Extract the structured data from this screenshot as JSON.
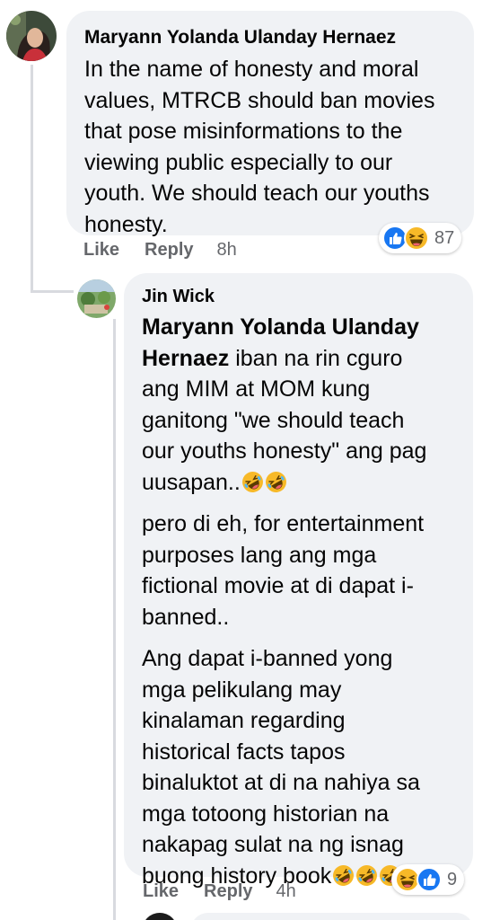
{
  "comment1": {
    "author": "Maryann Yolanda Ulanday Hernaez",
    "lines": [
      "In the name of honesty and moral",
      "values, MTRCB should ban movies",
      "that pose misinformations to the",
      "viewing public especially to our",
      "youth. We should teach our youths",
      "honesty."
    ],
    "actions": {
      "like": "Like",
      "reply": "Reply",
      "time": "8h"
    },
    "reactions": {
      "icons": [
        "like-icon",
        "haha-icon"
      ],
      "count": "87"
    }
  },
  "reply1": {
    "author": "Jin Wick",
    "mention_line1": "Maryann Yolanda Ulanday",
    "mention_line2": "Hernaez",
    "mention_tail": " iban na rin cguro",
    "p1_lines": [
      "ang MIM at MOM kung",
      "ganitong \"we should teach",
      "our youths honesty\" ang pag",
      "uusapan.."
    ],
    "p2_lines": [
      "pero di eh, for entertainment",
      "purposes lang ang mga",
      "fictional movie at di dapat i-",
      "banned.."
    ],
    "p3_lines": [
      "Ang dapat i-banned yong",
      "mga pelikulang may",
      "kinalaman regarding",
      "historical facts tapos",
      "binaluktot at di na nahiya sa",
      "mga totoong historian na",
      "nakapag sulat na ng isnag",
      "buong history book"
    ],
    "emoji_names": [
      "rolling-on-floor-laughing-icon"
    ],
    "actions": {
      "like": "Like",
      "reply": "Reply",
      "time": "4h"
    },
    "reactions": {
      "icons": [
        "haha-icon",
        "like-icon"
      ],
      "count": "9"
    }
  },
  "colors": {
    "bubble": "#f0f2f5",
    "text": "#050505",
    "secondary": "#65676b",
    "like_blue": "#1877f2",
    "haha_yellow": "#f7b928"
  }
}
